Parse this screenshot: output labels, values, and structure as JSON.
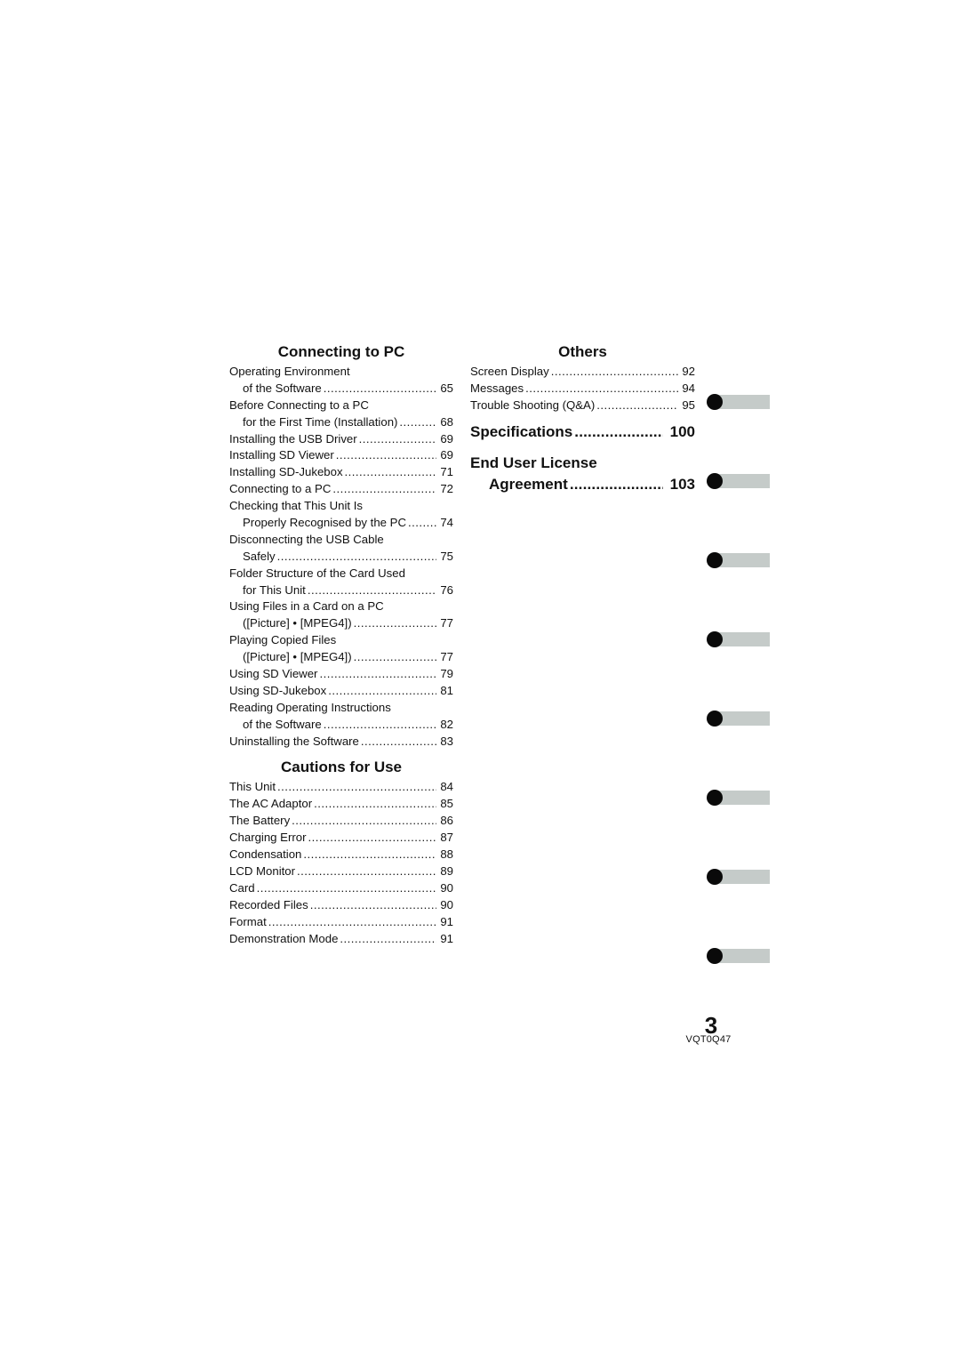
{
  "left_column": {
    "connecting": {
      "title": "Connecting to PC",
      "entries": [
        {
          "line1": "Operating Environment",
          "line2": "of the Software",
          "page": "65"
        },
        {
          "line1": "Before Connecting to a PC",
          "line2": "for the First Time (Installation)",
          "page": "68"
        },
        {
          "text": "Installing the USB Driver",
          "page": "69"
        },
        {
          "text": "Installing SD Viewer",
          "page": "69"
        },
        {
          "text": "Installing SD-Jukebox",
          "page": "71"
        },
        {
          "text": "Connecting to a PC",
          "page": "72"
        },
        {
          "line1": "Checking that This Unit Is",
          "line2": "Properly Recognised by the PC",
          "page": "74"
        },
        {
          "line1": "Disconnecting the USB Cable",
          "line2": "Safely",
          "page": "75"
        },
        {
          "line1": "Folder Structure of the Card Used",
          "line2": "for This Unit",
          "page": "76"
        },
        {
          "line1": "Using Files in a Card on a PC",
          "line2": "([Picture] • [MPEG4])",
          "page": "77"
        },
        {
          "line1": "Playing Copied Files",
          "line2": "([Picture] • [MPEG4])",
          "page": "77"
        },
        {
          "text": "Using SD Viewer",
          "page": "79"
        },
        {
          "text": "Using SD-Jukebox",
          "page": "81"
        },
        {
          "line1": "Reading Operating Instructions",
          "line2": "of the Software",
          "page": "82"
        },
        {
          "text": "Uninstalling the Software",
          "page": "83"
        }
      ]
    },
    "cautions": {
      "title": "Cautions for Use",
      "entries": [
        {
          "text": "This Unit",
          "page": "84"
        },
        {
          "text": "The AC Adaptor",
          "page": "85"
        },
        {
          "text": "The Battery",
          "page": "86"
        },
        {
          "text": "Charging Error",
          "page": "87"
        },
        {
          "text": "Condensation",
          "page": "88"
        },
        {
          "text": "LCD Monitor",
          "page": "89"
        },
        {
          "text": "Card",
          "page": "90"
        },
        {
          "text": "Recorded Files",
          "page": "90"
        },
        {
          "text": "Format",
          "page": "91"
        },
        {
          "text": "Demonstration Mode",
          "page": "91"
        }
      ]
    }
  },
  "right_column": {
    "others": {
      "title": "Others",
      "entries": [
        {
          "text": "Screen Display",
          "page": "92"
        },
        {
          "text": "Messages",
          "page": "94"
        },
        {
          "text": "Trouble Shooting (Q&A)",
          "page": "95"
        }
      ]
    },
    "specifications": {
      "text": "Specifications",
      "page": "100"
    },
    "eula": {
      "line1": "End User License",
      "line2": "Agreement",
      "page": "103"
    }
  },
  "side_tabs": {
    "count": 8,
    "bar_color": "#c5cbc9",
    "dot_color": "#0a0a0a"
  },
  "footer": {
    "page_number": "3",
    "doc_id": "VQT0Q47"
  }
}
